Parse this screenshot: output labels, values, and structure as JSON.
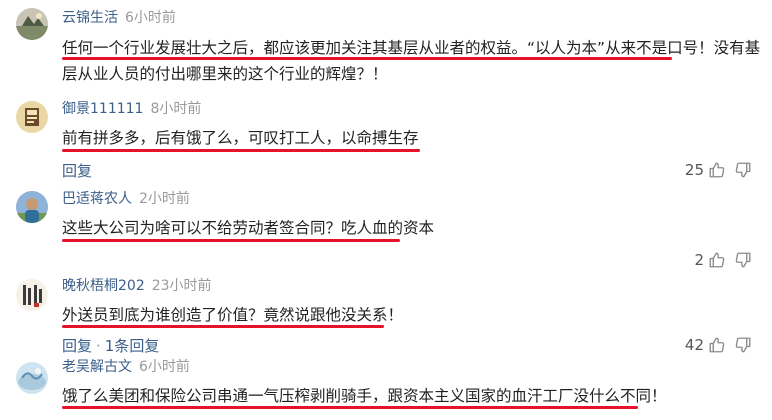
{
  "comments": [
    {
      "username": "云锦生活",
      "time": "6小时前",
      "text": "任何一个行业发展壮大之后，都应该更加关注其基层从业者的权益。“以人为本”从来不是口号！没有基层从业人员的付出哪里来的这个行业的辉煌？！"
    },
    {
      "username": "御景111111",
      "time": "8小时前",
      "text": "前有拼多多，后有饿了么，可叹打工人，以命搏生存",
      "reply_label": "回复",
      "likes": "25"
    },
    {
      "username": "巴适蒋农人",
      "time": "2小时前",
      "text": "这些大公司为啥可以不给劳动者签合同？吃人血的资本"
    },
    {
      "username": "晚秋梧桐202",
      "time": "23小时前",
      "text": "外送员到底为谁创造了价值？竟然说跟他没关系！",
      "reply_label": "回复",
      "reply_count_label": "1条回复",
      "likes": "2"
    },
    {
      "username": "老吴解古文",
      "time": "6小时前",
      "text": "饿了么美团和保险公司串通一气压榨剥削骑手，跟资本主义国家的血汗工厂没什么不同！",
      "likes": "42"
    }
  ],
  "icons": {
    "like": "thumbs-up-icon",
    "dislike": "thumbs-down-icon"
  },
  "colors": {
    "username": "#3b5f8a",
    "time": "#9a9a9a",
    "underline": "#e8102a"
  }
}
